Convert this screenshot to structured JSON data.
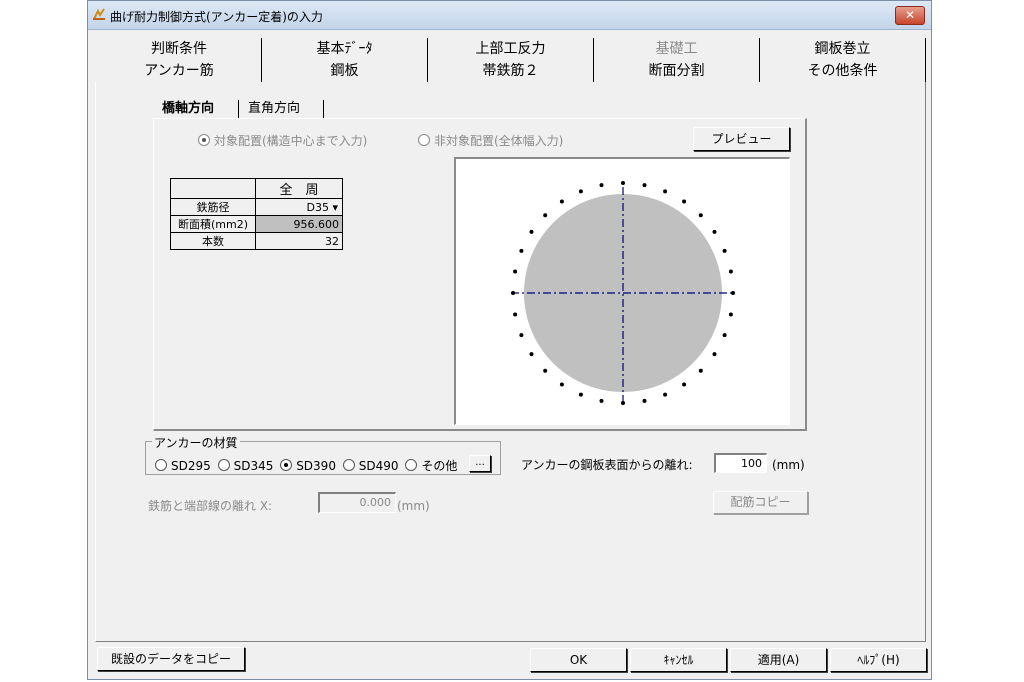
{
  "window": {
    "title": "曲げ耐力制御方式(アンカー定着)の入力",
    "close_label": "✕"
  },
  "tabs_row1": [
    "判断条件",
    "基本ﾃﾞｰﾀ",
    "上部工反力",
    "基礎工",
    "鋼板巻立"
  ],
  "tabs_row2": [
    "アンカー筋",
    "鋼板",
    "帯鉄筋２",
    "断面分割",
    "その他条件"
  ],
  "subtabs": {
    "active": "橋軸方向",
    "other": "直角方向"
  },
  "placement": {
    "symmetric": "対象配置(構造中心まで入力)",
    "asymmetric": "非対象配置(全体幅入力)",
    "preview_button": "プレビュー"
  },
  "rebar_table": {
    "column_header": "全　周",
    "rows": [
      {
        "label": "鉄筋径",
        "value": "D35"
      },
      {
        "label": "断面積(mm2)",
        "value": "956.600"
      },
      {
        "label": "本数",
        "value": "32"
      }
    ]
  },
  "material": {
    "legend": "アンカーの材質",
    "options": [
      "SD295",
      "SD345",
      "SD390",
      "SD490",
      "その他"
    ],
    "selected": "SD390",
    "more_button": "..."
  },
  "anchor_distance": {
    "label": "アンカーの鋼板表面からの離れ:",
    "value": "100",
    "unit": "(mm)"
  },
  "edge_distance": {
    "label": "鉄筋と端部線の離れ  X:",
    "value": "0.000",
    "unit": "(mm)"
  },
  "copy_rebar_button": "配筋コピー",
  "footer": {
    "copy_existing": "既設のデータをコピー",
    "ok": "OK",
    "cancel": "ｷｬﾝｾﾙ",
    "apply": "適用(A)",
    "help": "ﾍﾙﾌﾟ(H)"
  },
  "preview_chart": {
    "rebar_count": 32
  }
}
